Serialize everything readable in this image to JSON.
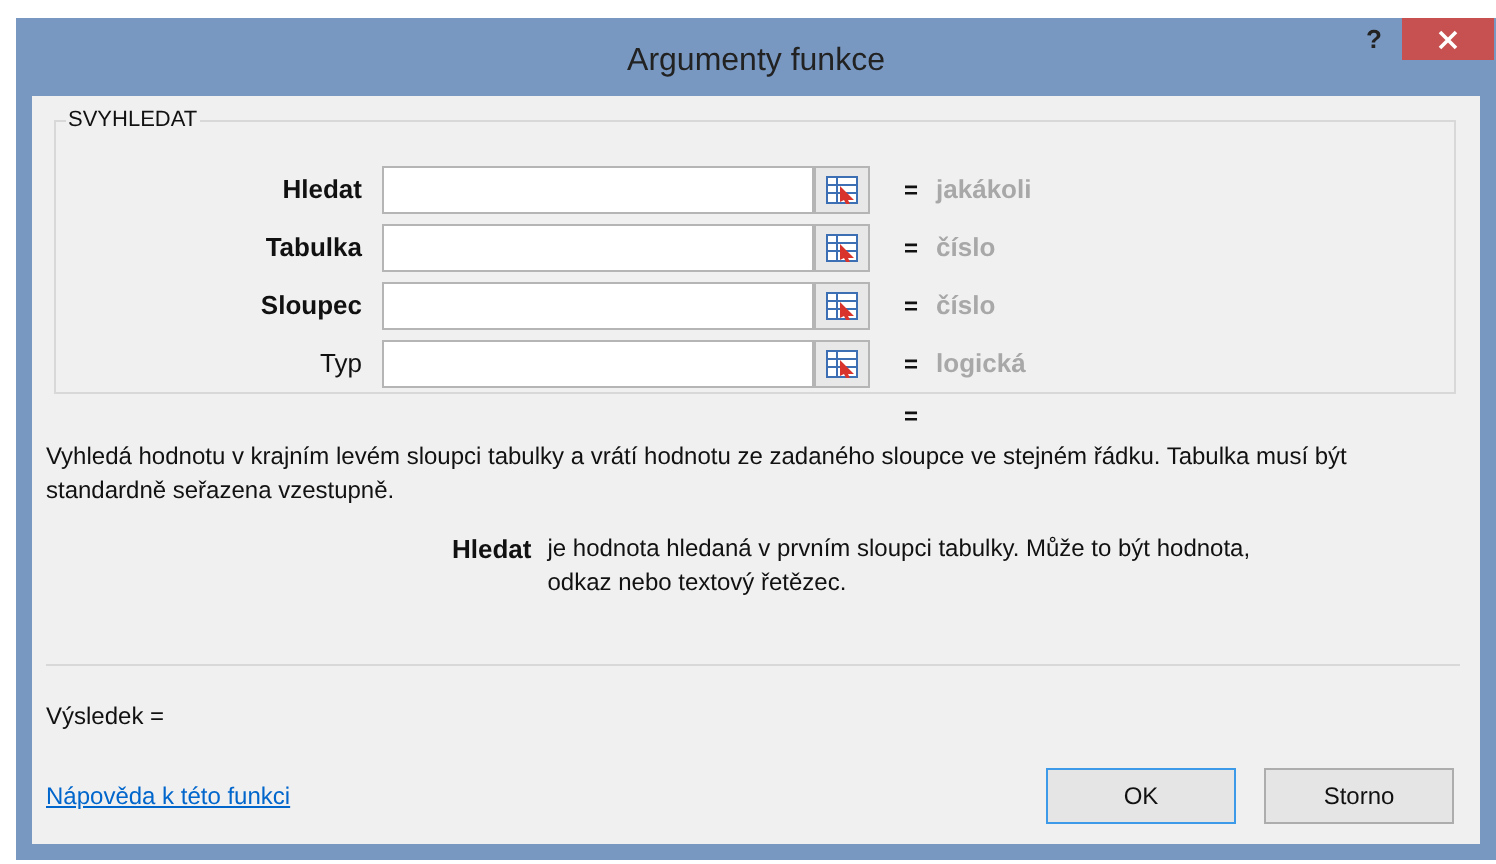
{
  "window": {
    "title": "Argumenty funkce",
    "help": "?"
  },
  "group": {
    "title": "SVYHLEDAT"
  },
  "arguments": [
    {
      "label": "Hledat",
      "required": true,
      "result": "jakákoli"
    },
    {
      "label": "Tabulka",
      "required": true,
      "result": "číslo"
    },
    {
      "label": "Sloupec",
      "required": true,
      "result": "číslo"
    },
    {
      "label": "Typ",
      "required": false,
      "result": "logická"
    }
  ],
  "equals": "=",
  "formula_result": "=",
  "description": "Vyhledá hodnotu v krajním levém sloupci tabulky a vrátí hodnotu ze zadaného sloupce ve stejném řádku. Tabulka musí být standardně seřazena vzestupně.",
  "argument_help": {
    "name": "Hledat",
    "text": "je hodnota hledaná v prvním sloupci tabulky. Může to být hodnota, odkaz nebo textový řetězec."
  },
  "result_label": "Výsledek =",
  "help_link": "Nápověda k této funkci",
  "buttons": [
    {
      "label": "OK",
      "default": true
    },
    {
      "label": "Storno",
      "default": false
    }
  ]
}
